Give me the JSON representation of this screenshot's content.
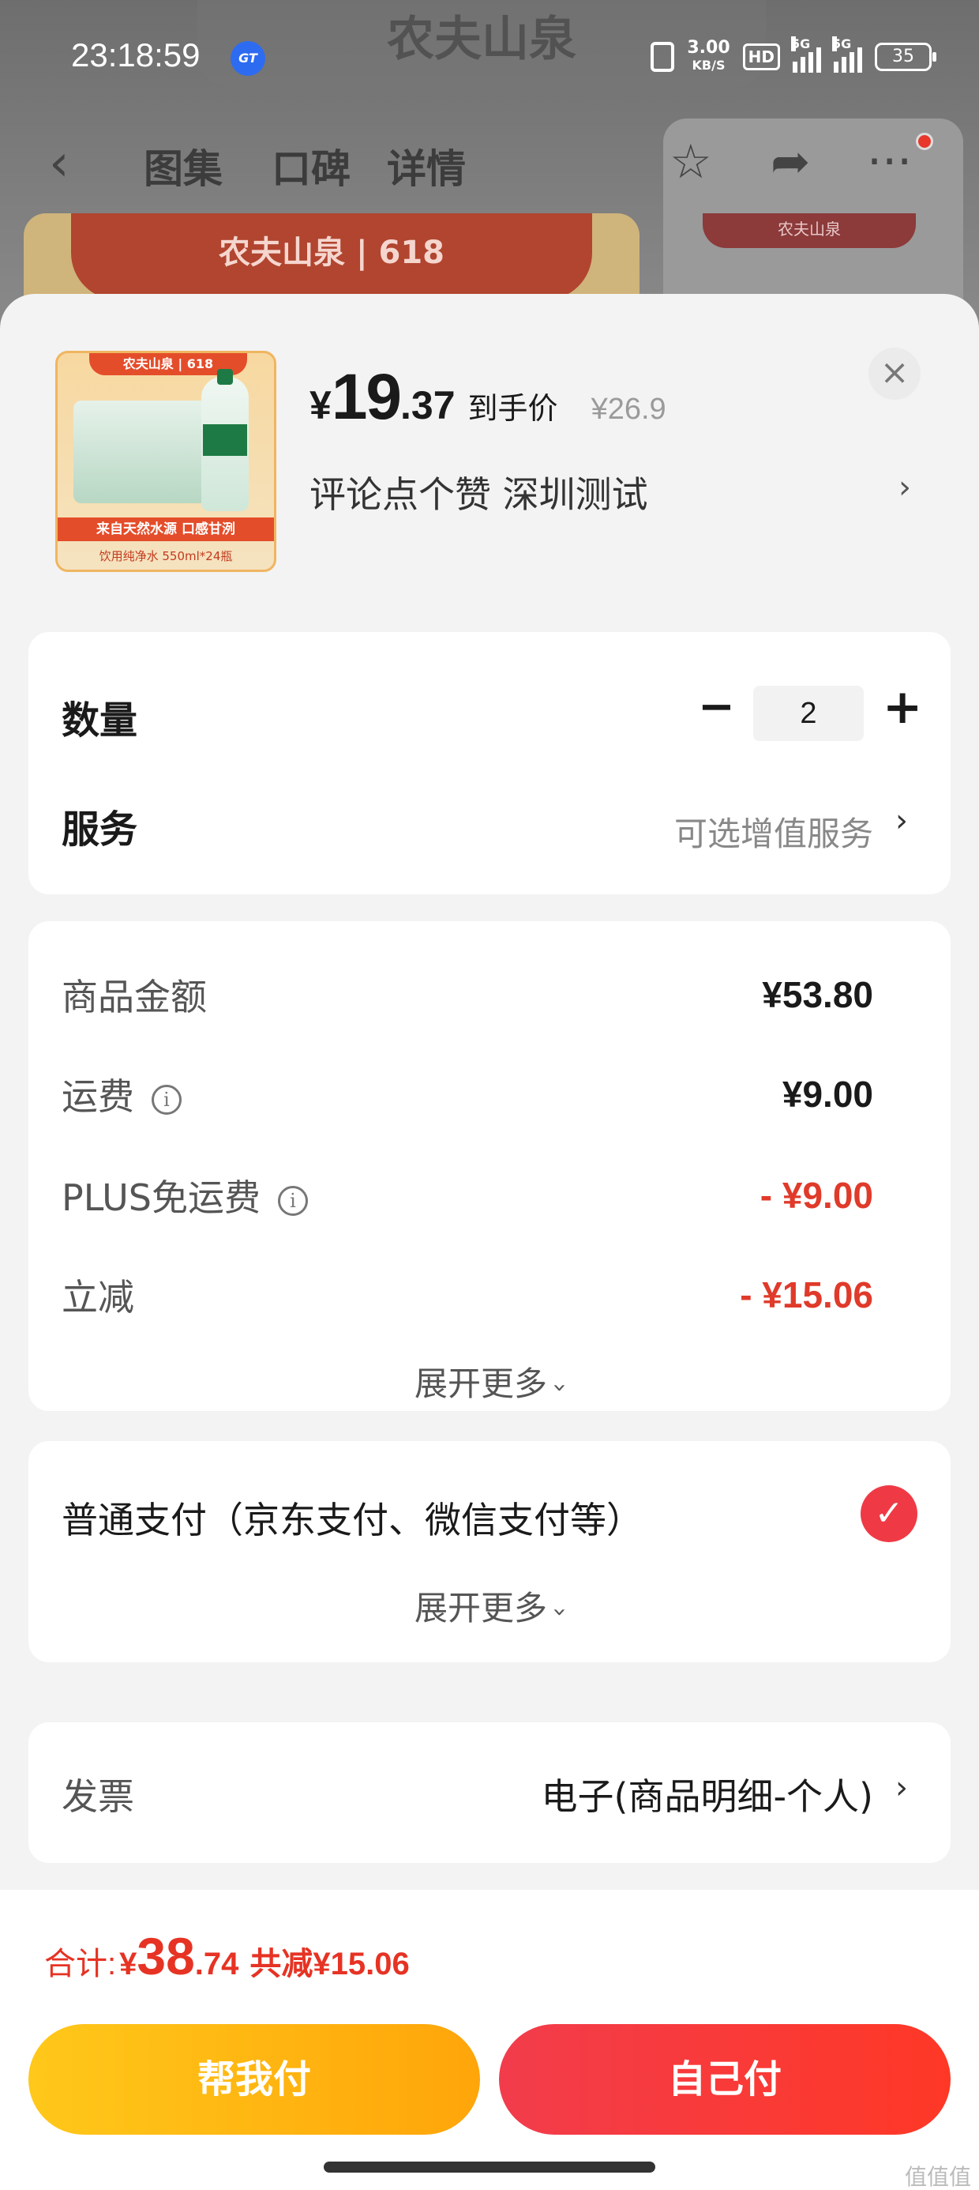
{
  "status_bar": {
    "time": "23:18:59",
    "app_badge": "GT",
    "net_speed": "3.00",
    "net_unit": "KB/S",
    "hd_badge": "HD",
    "signal1_label": "5G",
    "signal2_label": "5G",
    "battery": "35"
  },
  "background": {
    "brand": "农夫山泉",
    "badge": "618",
    "bottle_label": "农夫山泉"
  },
  "nav": {
    "tabs": [
      "图集",
      "口碑",
      "详情"
    ]
  },
  "product": {
    "image_banner": "农夫山泉 | 618",
    "image_slogan": "来自天然水源 口感甘洌",
    "image_spec": "饮用纯净水 550ml*24瓶",
    "price_symbol": "¥",
    "price_int": "19",
    "price_dec": ".37",
    "price_label": "到手价",
    "original_price": "¥26.9",
    "spec_text": "评论点个赞  深圳测试"
  },
  "quantity_card": {
    "qty_label": "数量",
    "qty_value": "2",
    "minus": "−",
    "plus": "+",
    "service_label": "服务",
    "service_value": "可选增值服务"
  },
  "amount_card": {
    "rows": [
      {
        "label": "商品金额",
        "value": "¥53.80"
      },
      {
        "label": "运费",
        "value": "¥9.00"
      },
      {
        "label": "PLUS免运费",
        "value": "- ¥9.00"
      },
      {
        "label": "立减",
        "value": "- ¥15.06"
      }
    ],
    "expand_label": "展开更多"
  },
  "payment_card": {
    "method": "普通支付（京东支付、微信支付等）",
    "expand_label": "展开更多"
  },
  "invoice_card": {
    "label": "发票",
    "value": "电子(商品明细-个人)"
  },
  "footer": {
    "total_label": "合计:",
    "total_symbol": "¥",
    "total_int": "38",
    "total_dec": ".74",
    "discount": "共减¥15.06",
    "help_pay": "帮我付",
    "self_pay": "自己付",
    "watermark": "值值值"
  },
  "colors": {
    "accent_red": "#e63324",
    "help_button": "#ffb30f",
    "self_button": "#f23a3a"
  }
}
